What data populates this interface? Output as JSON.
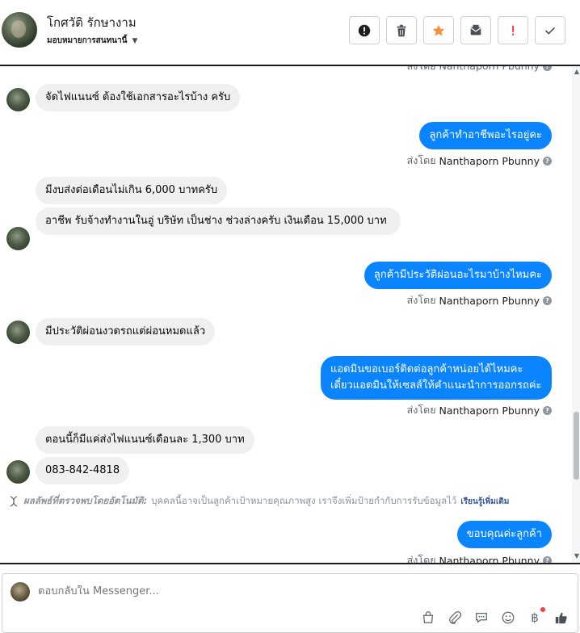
{
  "header": {
    "contact_name": "โกศวัติ รักษางาม",
    "assign_label": "มอบหมายการสนทนานี้",
    "actions": [
      {
        "name": "spam-button",
        "icon": "alert-circle-icon"
      },
      {
        "name": "delete-button",
        "icon": "trash-icon"
      },
      {
        "name": "star-button",
        "icon": "star-icon",
        "color": "#f7923b"
      },
      {
        "name": "mark-unread-button",
        "icon": "mail-icon"
      },
      {
        "name": "follow-up-button",
        "icon": "exclamation-icon",
        "color": "#fa383e"
      },
      {
        "name": "done-button",
        "icon": "check-icon"
      }
    ]
  },
  "chat": {
    "clipped_sentby": "ส่งโดย Nanthaporn Pbunny",
    "messages": [
      {
        "dir": "in",
        "text": "จัดไฟแนนซ์ ต้องใช้เอกสารอะไรบ้าง ครับ"
      },
      {
        "dir": "out",
        "text": "ลูกค้าทำอาชีพอะไรอยู่คะ",
        "sent_by_prefix": "ส่งโดย",
        "sender": "Nanthaporn Pbunny"
      },
      {
        "dir": "in",
        "text": "มีงบส่งต่อเดือนไม่เกิน 6,000 บาทครับ"
      },
      {
        "dir": "in",
        "text": "อาชีพ รับจ้างทำงานในอู่ บริษัท เป็นช่าง ช่วงล่างครับ เงินเดือน 15,000 บาท"
      },
      {
        "dir": "out",
        "text": "ลูกค้ามีประวัติผ่อนอะไรมาบ้างไหมคะ",
        "sent_by_prefix": "ส่งโดย",
        "sender": "Nanthaporn Pbunny"
      },
      {
        "dir": "in",
        "text": "มีประวัติผ่อนงวดรถแต่ผ่อนหมดแล้ว"
      },
      {
        "dir": "out",
        "text": "แอดมินขอเบอร์ติดต่อลูกค้าหน่อยได้ไหมคะ เดี๋ยวแอดมินให้เซลส์ให้คำแนะนำการออกรถค่ะ",
        "sent_by_prefix": "ส่งโดย",
        "sender": "Nanthaporn Pbunny"
      },
      {
        "dir": "in",
        "text": "ตอนนี้ก็มีแค่ส่งไฟแนนซ์เดือนละ 1,300 บาท"
      },
      {
        "dir": "in",
        "text": "083-842-4818"
      },
      {
        "dir": "out",
        "text": "ขอบคุณค่ะลูกค้า",
        "sent_by_prefix": "ส่งโดย",
        "sender": "Nanthaporn Pbunny"
      }
    ],
    "auto_detect": {
      "title": "ผลลัพธ์ที่ตรวจพบโดยอัตโนมัติ:",
      "body": "บุคคลนี้อาจเป็นลูกค้าเป้าหมายคุณภาพสูง เราจึงเพิ่มป้ายกำกับการรับข้อมูลไว้",
      "link": "เรียนรู้เพิ่มเติม"
    }
  },
  "composer": {
    "placeholder": "ตอบกลับใน Messenger...",
    "tools": [
      "bag-icon",
      "paperclip-icon",
      "saved-reply-icon",
      "emoji-icon",
      "baht-icon",
      "thumbs-up-icon"
    ]
  },
  "colors": {
    "outgoing_bubble": "#0a84ff",
    "incoming_bubble": "#f0f0f0",
    "link": "#385898"
  }
}
